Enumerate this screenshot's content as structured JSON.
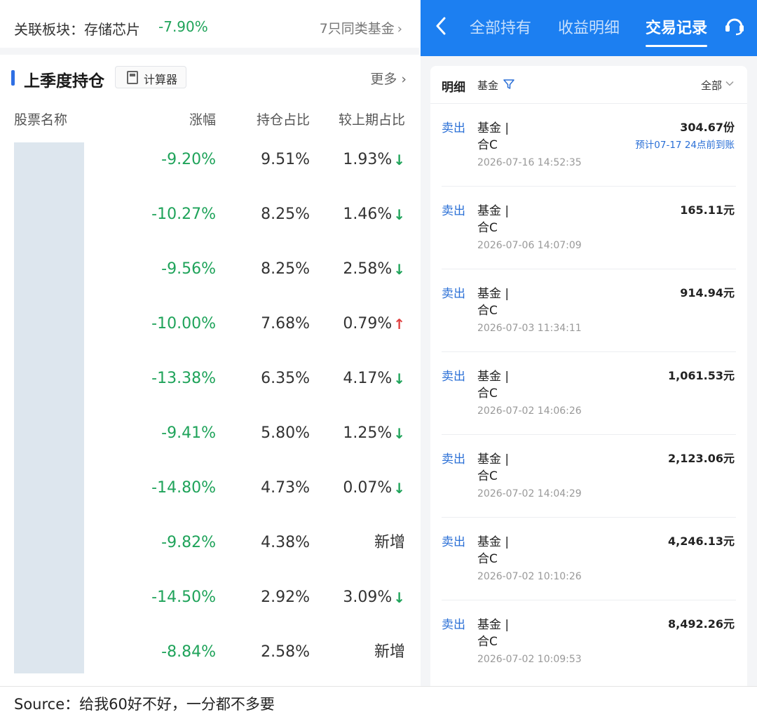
{
  "left": {
    "related_label": "关联板块：存储芯片",
    "related_change": "-7.90%",
    "same_funds": "7只同类基金",
    "section_title": "上季度持仓",
    "calc_label": "计算器",
    "more_label": "更多",
    "columns": {
      "name": "股票名称",
      "change": "涨幅",
      "ratio": "持仓占比",
      "prev": "较上期占比"
    },
    "rows": [
      {
        "change": "-9.20%",
        "ratio": "9.51%",
        "prev": "1.93%",
        "dir": "down"
      },
      {
        "change": "-10.27%",
        "ratio": "8.25%",
        "prev": "1.46%",
        "dir": "down"
      },
      {
        "change": "-9.56%",
        "ratio": "8.25%",
        "prev": "2.58%",
        "dir": "down"
      },
      {
        "change": "-10.00%",
        "ratio": "7.68%",
        "prev": "0.79%",
        "dir": "up"
      },
      {
        "change": "-13.38%",
        "ratio": "6.35%",
        "prev": "4.17%",
        "dir": "down"
      },
      {
        "change": "-9.41%",
        "ratio": "5.80%",
        "prev": "1.25%",
        "dir": "down"
      },
      {
        "change": "-14.80%",
        "ratio": "4.73%",
        "prev": "0.07%",
        "dir": "down"
      },
      {
        "change": "-9.82%",
        "ratio": "4.38%",
        "prev": "新增",
        "dir": "none"
      },
      {
        "change": "-14.50%",
        "ratio": "2.92%",
        "prev": "3.09%",
        "dir": "down"
      },
      {
        "change": "-8.84%",
        "ratio": "2.58%",
        "prev": "新增",
        "dir": "none"
      }
    ],
    "colors": {
      "down": "#1fa35a",
      "up": "#e04040"
    }
  },
  "right": {
    "nav": {
      "tabs": [
        "全部持有",
        "收益明细",
        "交易记录"
      ],
      "active_index": 2
    },
    "filter": {
      "detail": "明细",
      "fund": "基金",
      "all": "全部"
    },
    "transactions": [
      {
        "type": "卖出",
        "name1": "基金 |",
        "name2": "合C",
        "time": "2026-07-16 14:52:35",
        "amount": "304.67份",
        "note": "预计07-17 24点前到账"
      },
      {
        "type": "卖出",
        "name1": "基金 |",
        "name2": "合C",
        "time": "2026-07-06 14:07:09",
        "amount": "165.11元",
        "note": ""
      },
      {
        "type": "卖出",
        "name1": "基金 |",
        "name2": "合C",
        "time": "2026-07-03 11:34:11",
        "amount": "914.94元",
        "note": ""
      },
      {
        "type": "卖出",
        "name1": "基金 |",
        "name2": "合C",
        "time": "2026-07-02 14:06:26",
        "amount": "1,061.53元",
        "note": ""
      },
      {
        "type": "卖出",
        "name1": "基金 |",
        "name2": "合C",
        "time": "2026-07-02 14:04:29",
        "amount": "2,123.06元",
        "note": ""
      },
      {
        "type": "卖出",
        "name1": "基金 |",
        "name2": "合C",
        "time": "2026-07-02 10:10:26",
        "amount": "4,246.13元",
        "note": ""
      },
      {
        "type": "卖出",
        "name1": "基金 |",
        "name2": "合C",
        "time": "2026-07-02 10:09:53",
        "amount": "8,492.26元",
        "note": ""
      }
    ],
    "accent": "#1c7ff1"
  },
  "footer": {
    "source": "Source：给我60好不好，一分都不多要"
  }
}
